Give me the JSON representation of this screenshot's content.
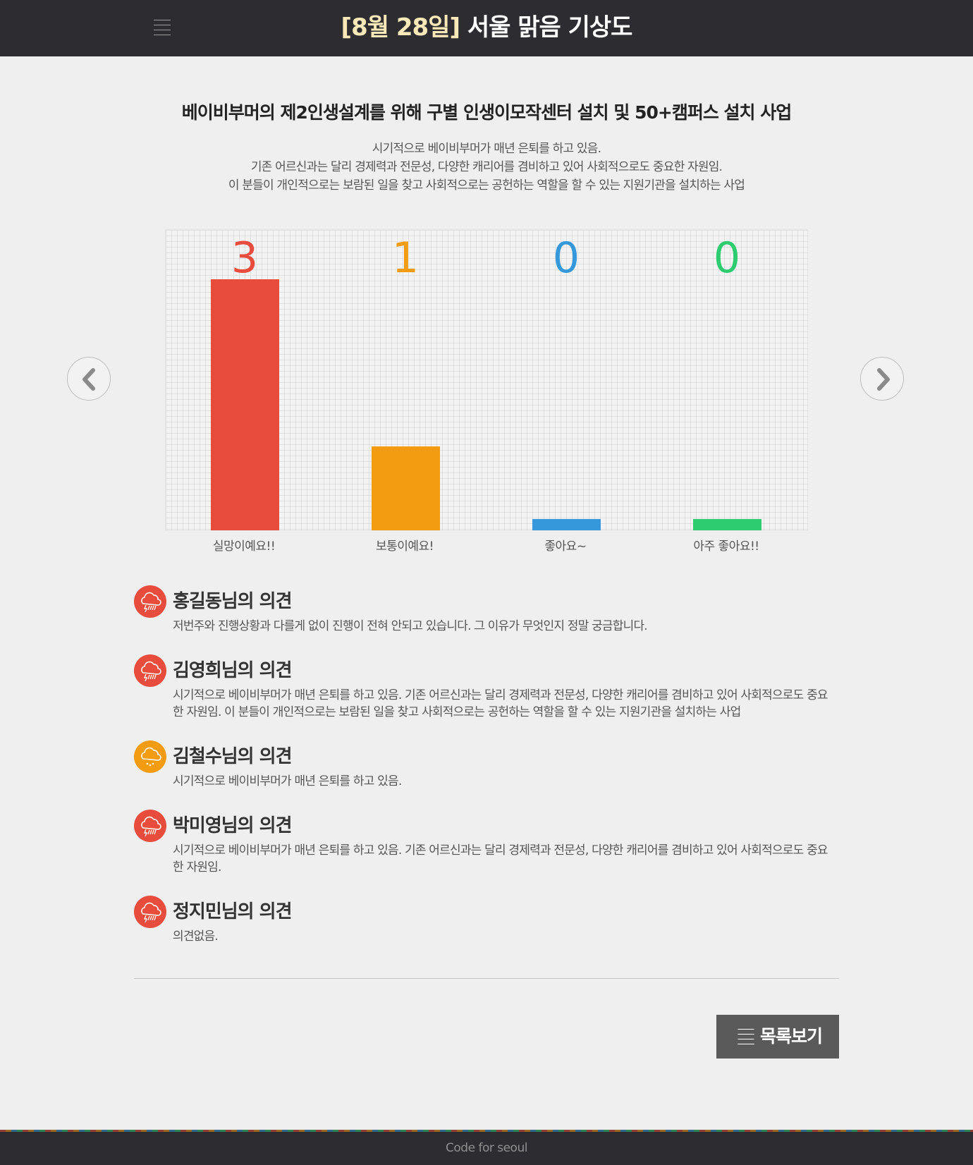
{
  "header": {
    "title_date": "[8월 28일]",
    "title_rest": "서울 맑음 기상도"
  },
  "topic": {
    "title": "베이비부머의 제2인생설계를 위해 구별 인생이모작센터 설치 및 50+캠퍼스 설치 사업",
    "description": [
      "시기적으로 베이비부머가 매년 은퇴를 하고 있음.",
      "기존 어르신과는 달리 경제력과 전문성, 다양한 캐리어를 겸비하고 있어 사회적으로도 중요한 자원임.",
      "이 분들이 개인적으로는 보람된 일을 찾고 사회적으로는 공헌하는 역할을 할 수 있는 지원기관을 설치하는 사업"
    ]
  },
  "chart_data": {
    "type": "bar",
    "categories": [
      "실망이예요!!",
      "보통이예요!",
      "좋아요~",
      "아주 좋아요!!"
    ],
    "values": [
      3,
      1,
      0,
      0
    ],
    "colors": [
      "#e84c3d",
      "#f39c12",
      "#3498db",
      "#2ecc71"
    ],
    "grid": true
  },
  "nav": {
    "prev_icon": "chevron-left-icon",
    "next_icon": "chevron-right-icon"
  },
  "opinions": [
    {
      "name": "홍길동님의 의견",
      "text": "저번주와 진행상황과 다를게 없이 진행이 전혀 안되고 있습니다. 그 이유가 무엇인지 정말 궁금합니다.",
      "icon": "thunderstorm-icon",
      "color": "#e84c3d"
    },
    {
      "name": "김영희님의 의견",
      "text": "시기적으로 베이비부머가 매년 은퇴를 하고 있음. 기존 어르신과는 달리 경제력과 전문성, 다양한 캐리어를 겸비하고 있어 사회적으로도 중요한 자원임. 이 분들이 개인적으로는 보람된 일을 찾고 사회적으로는 공헌하는 역할을 할 수 있는 지원기관을 설치하는 사업",
      "icon": "thunderstorm-icon",
      "color": "#e84c3d"
    },
    {
      "name": "김철수님의 의견",
      "text": "시기적으로 베이비부머가 매년 은퇴를 하고 있음.",
      "icon": "rain-cloud-icon",
      "color": "#f39c12"
    },
    {
      "name": "박미영님의 의견",
      "text": "시기적으로 베이비부머가 매년 은퇴를 하고 있음. 기존 어르신과는 달리 경제력과 전문성, 다양한 캐리어를 겸비하고 있어 사회적으로도 중요한 자원임.",
      "icon": "thunderstorm-icon",
      "color": "#e84c3d"
    },
    {
      "name": "정지민님의 의견",
      "text": "의견없음.",
      "icon": "thunderstorm-icon",
      "color": "#e84c3d"
    }
  ],
  "list_button": {
    "label": "목록보기",
    "icon": "list-icon"
  },
  "footer": {
    "text": "Code for seoul"
  }
}
